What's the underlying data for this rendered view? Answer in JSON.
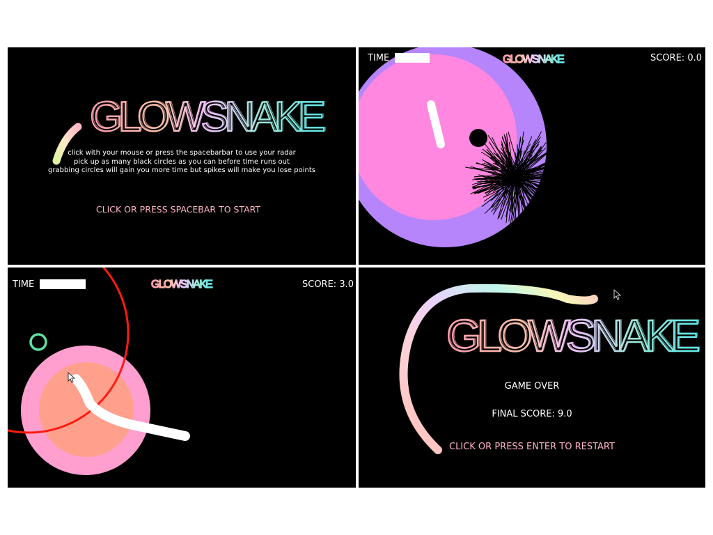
{
  "logo_text": "GLOWSNAKE",
  "colors": {
    "panel_bg": "#000000",
    "page_bg": "#ffffff",
    "accent_pink": "#ffb4c4",
    "radar_outer": "#b685fb",
    "radar_inner": "#ff87df",
    "ring_red": "#ff1a10",
    "small_ring": "#5ee0a4",
    "player_outer": "#ff9fcf",
    "player_inner": "#ffa08c",
    "snake": "#ffffff"
  },
  "start_screen": {
    "instructions": [
      "click with your mouse or press the spacebarbar to use your radar",
      "pick up as many black circles as you can before time runs out",
      "grabbing circles will gain you more time but spikes will make you lose points"
    ],
    "start_prompt": "CLICK OR PRESS SPACEBAR TO START"
  },
  "game_screen_1": {
    "time_label": "TIME",
    "time_remaining_fraction": 1.0,
    "score_label": "SCORE: 0.0"
  },
  "game_screen_2": {
    "time_label": "TIME",
    "time_remaining_fraction": 1.0,
    "score_label": "SCORE: 3.0"
  },
  "game_over_screen": {
    "game_over": "GAME OVER",
    "final_score": "FINAL SCORE: 9.0",
    "restart_prompt": "CLICK OR PRESS ENTER TO RESTART"
  }
}
